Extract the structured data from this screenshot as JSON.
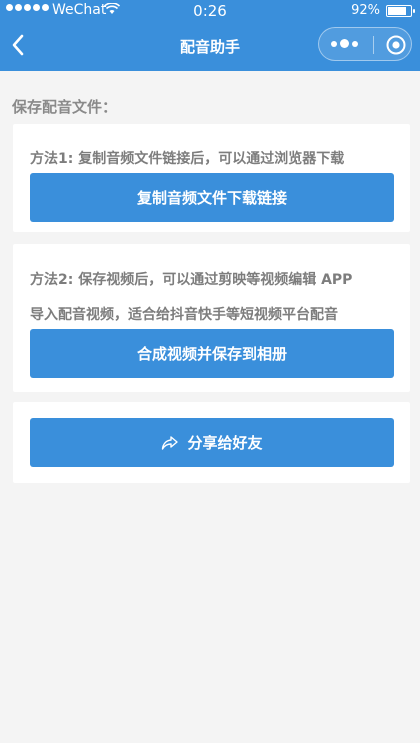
{
  "status_bar": {
    "carrier": "WeChat",
    "time": "0:26",
    "battery": "92%",
    "battery_level": 0.92
  },
  "nav": {
    "title": "配音助手",
    "back_icon": "chevron-left-icon",
    "more_icon": "more-dots-icon",
    "close_icon": "target-circle-icon"
  },
  "section": {
    "title": "保存配音文件："
  },
  "method1": {
    "text": "方法1: 复制音频文件链接后，可以通过浏览器下载",
    "button": "复制音频文件下载链接"
  },
  "method2": {
    "line1": "方法2: 保存视频后，可以通过剪映等视频编辑 APP",
    "line2": "导入配音视频，适合给抖音快手等短视频平台配音",
    "button": "合成视频并保存到相册"
  },
  "share": {
    "button": "分享给好友",
    "icon": "share-arrow-icon"
  },
  "colors": {
    "primary": "#3a8fdb",
    "background": "#f4f4f4"
  }
}
